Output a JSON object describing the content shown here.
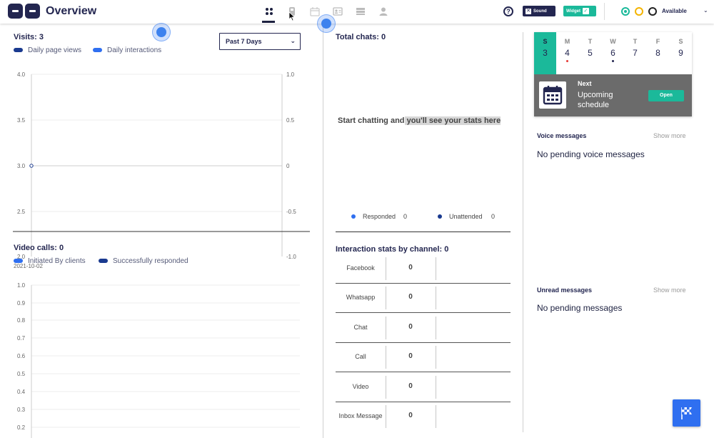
{
  "header": {
    "title": "Overview",
    "help_glyph": "?",
    "sound_label": "Sound",
    "widget_label": "Widget",
    "status_label": "Available",
    "nav_icons": [
      "grid-icon",
      "mobile-icon",
      "calendar-icon",
      "contact-card-icon",
      "list-icon",
      "person-icon"
    ]
  },
  "visits": {
    "title": "Visits: 3",
    "legend": [
      "Daily page views",
      "Daily interactions"
    ],
    "select_value": "Past 7 Days",
    "y_left_ticks": [
      "4.0",
      "3.5",
      "3.0",
      "2.5",
      "2.0"
    ],
    "y_right_ticks": [
      "1.0",
      "0.5",
      "0",
      "-0.5",
      "-1.0"
    ],
    "x_tick": "2021-10-02"
  },
  "video_calls": {
    "title": "Video calls: 0",
    "legend": [
      "Initiated By clients",
      "Successfully responded"
    ],
    "y_ticks": [
      "1.0",
      "0.9",
      "0.8",
      "0.7",
      "0.6",
      "0.5",
      "0.4",
      "0.3",
      "0.2"
    ]
  },
  "chats": {
    "title": "Total chats: 0",
    "empty_part1": "Start chatting and",
    "empty_part2": " you'll see your stats here",
    "responded_label": "Responded",
    "responded_value": "0",
    "unattended_label": "Unattended",
    "unattended_value": "0"
  },
  "channels": {
    "title": "Interaction stats by channel: 0",
    "rows": [
      {
        "name": "Facebook",
        "value": "0"
      },
      {
        "name": "Whatsapp",
        "value": "0"
      },
      {
        "name": "Chat",
        "value": "0"
      },
      {
        "name": "Call",
        "value": "0"
      },
      {
        "name": "Video",
        "value": "0"
      },
      {
        "name": "Inbox Message",
        "value": "0"
      }
    ]
  },
  "calendar": {
    "days": [
      {
        "name": "S",
        "date": "3"
      },
      {
        "name": "M",
        "date": "4"
      },
      {
        "name": "T",
        "date": "5"
      },
      {
        "name": "W",
        "date": "6"
      },
      {
        "name": "T",
        "date": "7"
      },
      {
        "name": "F",
        "date": "8"
      },
      {
        "name": "S",
        "date": "9"
      }
    ],
    "next_label": "Next",
    "schedule_label": "Upcoming schedule",
    "open_label": "Open"
  },
  "voice": {
    "title": "Voice messages",
    "show_more": "Show more",
    "empty": "No pending voice messages"
  },
  "unread": {
    "title": "Unread messages",
    "show_more": "Show more",
    "empty": "No pending messages"
  },
  "colors": {
    "navy": "#232650",
    "teal": "#1bb99a",
    "blue": "#2f6ff0",
    "dark_blue": "#1a3a8f",
    "amber": "#f4b400",
    "red": "#e53935"
  }
}
